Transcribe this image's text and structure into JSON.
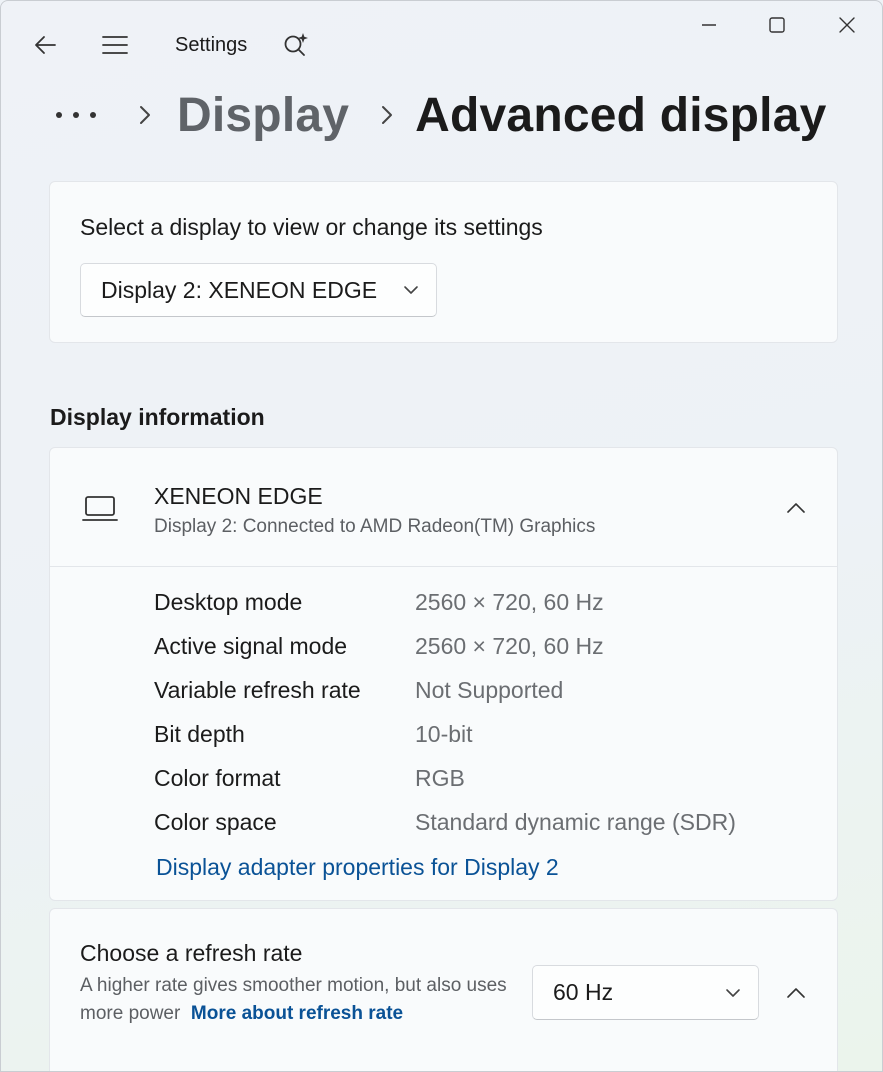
{
  "window": {
    "title": "Settings"
  },
  "breadcrumb": {
    "more": "•••",
    "parent": "Display",
    "current": "Advanced display"
  },
  "select_display": {
    "label": "Select a display to view or change its settings",
    "selected": "Display 2: XENEON EDGE"
  },
  "display_info": {
    "section_title": "Display information",
    "name": "XENEON EDGE",
    "subtitle": "Display 2: Connected to AMD Radeon(TM) Graphics",
    "properties": [
      {
        "label": "Desktop mode",
        "value": "2560 × 720, 60 Hz"
      },
      {
        "label": "Active signal mode",
        "value": "2560 × 720, 60 Hz"
      },
      {
        "label": "Variable refresh rate",
        "value": "Not Supported"
      },
      {
        "label": "Bit depth",
        "value": "10-bit"
      },
      {
        "label": "Color format",
        "value": "RGB"
      },
      {
        "label": "Color space",
        "value": "Standard dynamic range (SDR)"
      }
    ],
    "adapter_link": "Display adapter properties for Display 2"
  },
  "refresh_rate": {
    "title": "Choose a refresh rate",
    "description": "A higher rate gives smoother motion, but also uses more power",
    "link": "More about refresh rate",
    "selected": "60 Hz"
  },
  "icons": {
    "back": "back-arrow-icon",
    "menu": "hamburger-menu-icon",
    "copilot": "sparkle-search-icon",
    "minimize": "minimize-icon",
    "maximize": "maximize-icon",
    "close": "close-icon",
    "monitor": "laptop-icon",
    "chevron_down": "chevron-down-icon",
    "chevron_up": "chevron-up-icon",
    "chevron_right": "chevron-right-icon"
  },
  "colors": {
    "link": "#0a5296",
    "card_background": "#f9fbfc",
    "secondary_text": "#6b6e72"
  }
}
